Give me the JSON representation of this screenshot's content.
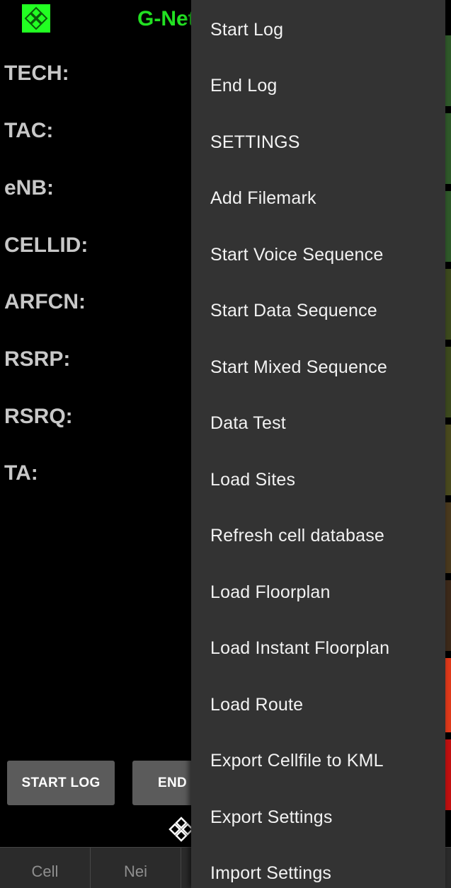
{
  "app": {
    "title": "G-Net"
  },
  "fields": [
    {
      "label": "TECH:"
    },
    {
      "label": "TAC:"
    },
    {
      "label": "eNB:"
    },
    {
      "label": "CELLID:"
    },
    {
      "label": "ARFCN:"
    },
    {
      "label": "RSRP:"
    },
    {
      "label": "RSRQ:"
    },
    {
      "label": "TA:"
    }
  ],
  "buttons": {
    "start_log": "START LOG",
    "end_log": "END LOG"
  },
  "tabs": [
    {
      "label": "Cell"
    },
    {
      "label": "Nei"
    }
  ],
  "menu": {
    "items": [
      {
        "label": "Start Log"
      },
      {
        "label": "End Log"
      },
      {
        "label": "SETTINGS"
      },
      {
        "label": "Add Filemark"
      },
      {
        "label": "Start Voice Sequence"
      },
      {
        "label": "Start Data Sequence"
      },
      {
        "label": "Start Mixed Sequence"
      },
      {
        "label": "Data Test"
      },
      {
        "label": "Load Sites"
      },
      {
        "label": "Refresh cell database"
      },
      {
        "label": "Load Floorplan"
      },
      {
        "label": "Load Instant Floorplan"
      },
      {
        "label": "Load Route"
      },
      {
        "label": "Export Cellfile to KML"
      },
      {
        "label": "Export Settings"
      },
      {
        "label": "Import Settings"
      }
    ]
  },
  "colors": {
    "accent_green": "#22e022",
    "menu_background": "#333333",
    "button_background": "#5b5b5b",
    "strip_green": "#2f5a2a",
    "strip_olive": "#4a4a1e",
    "strip_red": "#e03a1a",
    "strip_darkred": "#c21010"
  },
  "icons": {
    "app_logo": "gnet-logo-icon",
    "bottom_logo": "gnet-logo-icon"
  }
}
